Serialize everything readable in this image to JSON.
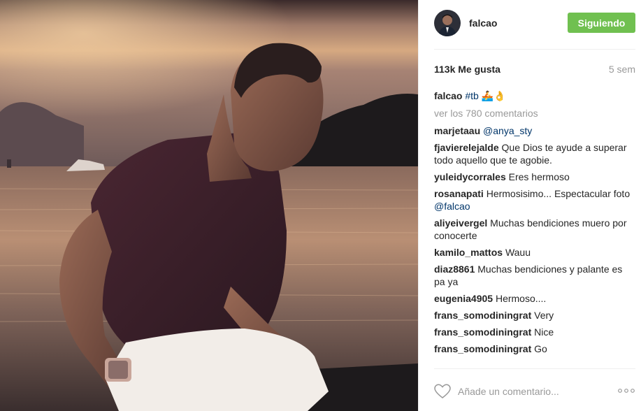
{
  "post": {
    "username": "falcao",
    "follow_label": "Siguiendo",
    "likes": "113k Me gusta",
    "time_ago": "5 sem",
    "caption_user": "falcao",
    "caption_tag": "#tb",
    "caption_emoji": "🚣👌",
    "view_all": "ver los 780 comentarios"
  },
  "comments": [
    {
      "user": "marjetaau",
      "text": "",
      "mention": "@anya_sty"
    },
    {
      "user": "fjavierelejalde",
      "text": "Que Dios te ayude a superar todo aquello que te agobie.",
      "mention": ""
    },
    {
      "user": "yuleidycorrales",
      "text": "Eres hermoso",
      "mention": ""
    },
    {
      "user": "rosanapati",
      "text": "Hermosisimo... Espectacular foto",
      "mention": "@falcao"
    },
    {
      "user": "aliyeivergel",
      "text": "Muchas bendiciones muero por conocerte",
      "mention": ""
    },
    {
      "user": "kamilo_mattos",
      "text": "Wauu",
      "mention": ""
    },
    {
      "user": "diaz8861",
      "text": "Muchas bendiciones y palante es pa ya",
      "mention": ""
    },
    {
      "user": "eugenia4905",
      "text": "Hermoso....",
      "mention": ""
    },
    {
      "user": "frans_somodiningrat",
      "text": "Very",
      "mention": ""
    },
    {
      "user": "frans_somodiningrat",
      "text": "Nice",
      "mention": ""
    },
    {
      "user": "frans_somodiningrat",
      "text": "Go",
      "mention": ""
    }
  ],
  "footer": {
    "comment_placeholder": "Añade un comentario...",
    "like_icon": "heart-icon",
    "more_icon": "more-options-icon"
  },
  "colors": {
    "follow_button": "#70c050",
    "link": "#003569",
    "muted": "#999999"
  }
}
